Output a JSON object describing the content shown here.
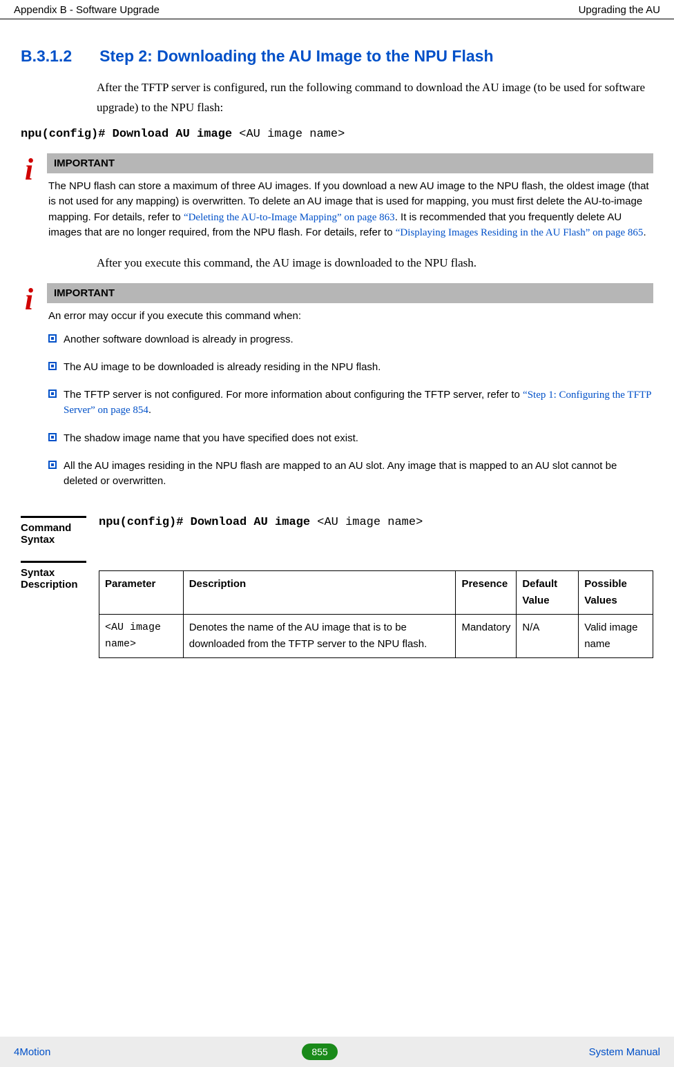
{
  "header": {
    "left": "Appendix B - Software Upgrade",
    "right": "Upgrading the AU"
  },
  "section": {
    "number": "B.3.1.2",
    "title": "Step 2: Downloading the AU Image to the NPU Flash"
  },
  "intro": "After the TFTP server is configured, run the following command to download the AU image (to be used for software upgrade) to the NPU flash:",
  "cmd": {
    "bold": "npu(config)# Download AU image ",
    "arg": "<AU image name>"
  },
  "note1": {
    "label": "IMPORTANT",
    "pre": "The NPU flash can store a maximum of three AU images. If you download a new AU image to the NPU flash, the oldest image (that is not used for any mapping) is overwritten. To delete an AU image that is used for mapping, you must first delete the AU-to-image mapping. For details, refer to ",
    "link1": "“Deleting the AU-to-Image Mapping” on page 863",
    "mid": ". It is recommended that you frequently delete AU images that are no longer required, from the NPU flash. For details, refer to ",
    "link2": "“Displaying Images Residing in the AU Flash” on page 865",
    "post": "."
  },
  "after1": "After you execute this command, the AU image is downloaded to the NPU flash.",
  "note2": {
    "label": "IMPORTANT",
    "lead": "An error may occur if you execute this command when:",
    "bullets": [
      {
        "text": "Another software download is already in progress."
      },
      {
        "text": "The AU image to be downloaded is already residing in the NPU flash."
      },
      {
        "pre": "The TFTP server is not configured. For more information about configuring the TFTP server, refer to ",
        "link": "“Step 1: Configuring the TFTP Server” on page 854",
        "post": "."
      },
      {
        "text": "The shadow image name that you have specified does not exist."
      },
      {
        "text": "All the AU images residing in the NPU flash are mapped to an AU slot. Any image that is mapped to an AU slot cannot be deleted or overwritten."
      }
    ]
  },
  "cmdSyntax": {
    "label": "Command Syntax",
    "bold": "npu(config)# Download AU image ",
    "arg": "<AU image name>"
  },
  "syntaxDesc": {
    "label": "Syntax Description",
    "headers": [
      "Parameter",
      "Description",
      "Presence",
      "Default Value",
      "Possible Values"
    ],
    "row": {
      "param": "<AU image name>",
      "desc": "Denotes the name of the AU image that is to be downloaded from the TFTP server to the NPU flash.",
      "presence": "Mandatory",
      "default": "N/A",
      "possible": "Valid image name"
    }
  },
  "footer": {
    "left": "4Motion",
    "page": "855",
    "right": "System Manual"
  }
}
